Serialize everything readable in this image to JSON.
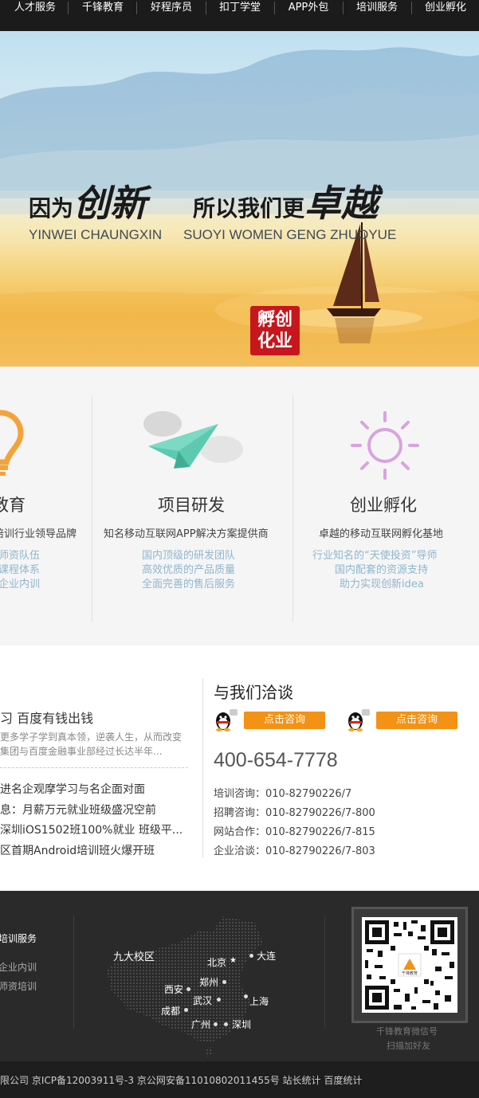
{
  "nav": {
    "items": [
      "人才服务",
      "千锋教育",
      "好程序员",
      "扣丁学堂",
      "APP外包",
      "培训服务",
      "创业孵化"
    ]
  },
  "banner": {
    "slogan_part1_small": "因为",
    "slogan_part1_big": "创新",
    "slogan_part2_small": "所以我们更",
    "slogan_part2_big": "卓越",
    "pinyin1": "YINWEI CHAUNGXIN",
    "pinyin2": "SUOYI WOMEN GENG ZHUOYUE",
    "seal_line1": "孵创",
    "seal_line2": "化业"
  },
  "services": [
    {
      "title": "教育",
      "subtitle": "培训行业领导品牌",
      "lines": [
        "师资队伍",
        "课程体系",
        "企业内训"
      ]
    },
    {
      "title": "项目研发",
      "subtitle": "知名移动互联网APP解决方案提供商",
      "lines": [
        "国内顶级的研发团队",
        "高效优质的产品质量",
        "全面完善的售后服务"
      ]
    },
    {
      "title": "创业孵化",
      "subtitle": "卓越的移动互联网孵化基地",
      "lines": [
        "行业知名的“天使投资”导师",
        "国内配套的资源支持",
        "助力实现创新idea"
      ]
    }
  ],
  "news": {
    "headline": "习 百度有钱出钱",
    "desc_line1": "更多学子学到真本领，逆袭人生，从而改变",
    "desc_line2": "集团与百度金融事业部经过长达半年...",
    "items": [
      "进名企观摩学习与名企面对面",
      "息：月薪万元就业班级盛况空前",
      "深圳iOS1502班100%就业 班级平...",
      "区首期Android培训班火爆开班"
    ]
  },
  "contact": {
    "title": "与我们洽谈",
    "consult_btn": "点击咨询",
    "phone": "400-654-7778",
    "lines": [
      "培训咨询：010-82790226/7",
      "招聘咨询：010-82790226/7-800",
      "网站合作：010-82790226/7-815",
      "企业洽谈：010-82790226/7-803"
    ]
  },
  "footer": {
    "col_title": "培训服务",
    "col_items": [
      "企业内训",
      "师资培训"
    ],
    "map_label": "九大校区",
    "cities": [
      "北京",
      "大连",
      "郑州",
      "西安",
      "武汉",
      "上海",
      "成都",
      "广州",
      "深圳"
    ],
    "qr_caption1": "千锋教育微信号",
    "qr_caption2": "扫描加好友",
    "qr_logo_text": "千锋教育"
  },
  "bottom": {
    "text": "限公司 京ICP备12003911号-3 京公网安备11010802011455号 站长统计 百度统计"
  },
  "colors": {
    "nav_bg": "#1b1b1b",
    "accent_orange": "#f39214",
    "service_line_blue": "#8fb6cd",
    "footer_bg": "#2a2a2a",
    "seal_red": "#c8161d"
  }
}
